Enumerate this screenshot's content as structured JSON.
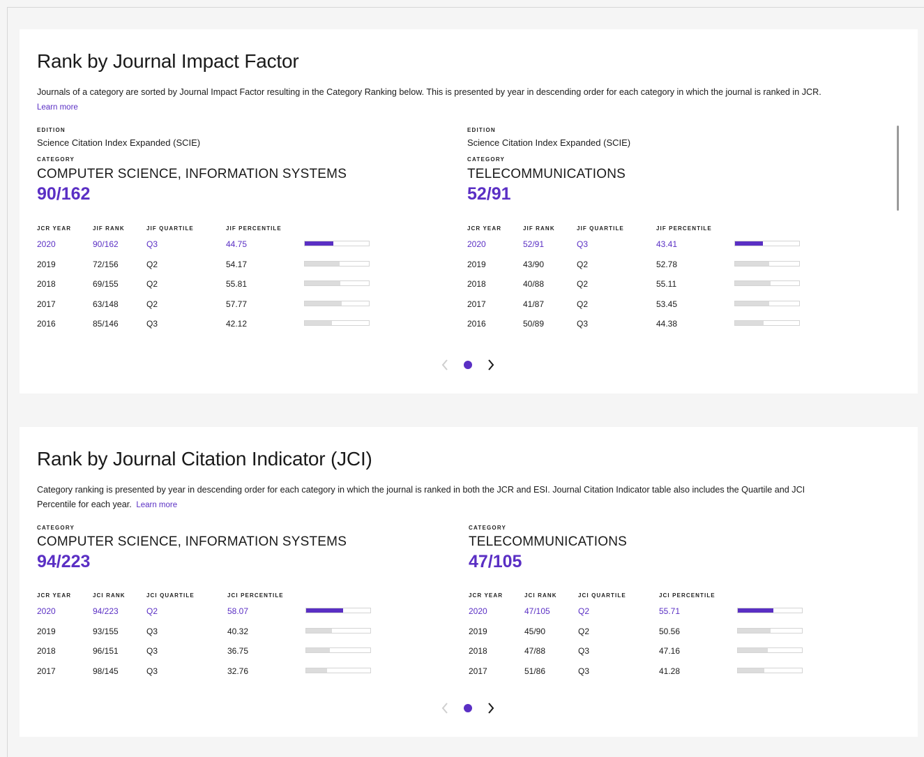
{
  "jif_section": {
    "title": "Rank by Journal Impact Factor",
    "description": "Journals of a category are sorted by Journal Impact Factor resulting in the Category Ranking below. This is presented by year in descending order for each category in which the journal is ranked in JCR.",
    "learn_more": "Learn more",
    "edition_label": "EDITION",
    "category_label": "CATEGORY",
    "headers": [
      "JCR YEAR",
      "JIF RANK",
      "JIF QUARTILE",
      "JIF PERCENTILE"
    ],
    "categories": [
      {
        "edition": "Science Citation Index Expanded (SCIE)",
        "name": "COMPUTER SCIENCE, INFORMATION SYSTEMS",
        "rank": "90/162",
        "rows": [
          {
            "year": "2020",
            "rank": "90/162",
            "quartile": "Q3",
            "percentile": "44.75"
          },
          {
            "year": "2019",
            "rank": "72/156",
            "quartile": "Q2",
            "percentile": "54.17"
          },
          {
            "year": "2018",
            "rank": "69/155",
            "quartile": "Q2",
            "percentile": "55.81"
          },
          {
            "year": "2017",
            "rank": "63/148",
            "quartile": "Q2",
            "percentile": "57.77"
          },
          {
            "year": "2016",
            "rank": "85/146",
            "quartile": "Q3",
            "percentile": "42.12"
          }
        ]
      },
      {
        "edition": "Science Citation Index Expanded (SCIE)",
        "name": "TELECOMMUNICATIONS",
        "rank": "52/91",
        "rows": [
          {
            "year": "2020",
            "rank": "52/91",
            "quartile": "Q3",
            "percentile": "43.41"
          },
          {
            "year": "2019",
            "rank": "43/90",
            "quartile": "Q2",
            "percentile": "52.78"
          },
          {
            "year": "2018",
            "rank": "40/88",
            "quartile": "Q2",
            "percentile": "55.11"
          },
          {
            "year": "2017",
            "rank": "41/87",
            "quartile": "Q2",
            "percentile": "53.45"
          },
          {
            "year": "2016",
            "rank": "50/89",
            "quartile": "Q3",
            "percentile": "44.38"
          }
        ]
      }
    ]
  },
  "jci_section": {
    "title": "Rank by Journal Citation Indicator (JCI)",
    "description": "Category ranking is presented by year in descending order for each category in which the journal is ranked in both the JCR and ESI. Journal Citation Indicator table also includes the Quartile and JCI Percentile for each year.",
    "learn_more": "Learn more",
    "category_label": "CATEGORY",
    "headers": [
      "JCR YEAR",
      "JCI RANK",
      "JCI QUARTILE",
      "JCI PERCENTILE"
    ],
    "categories": [
      {
        "name": "COMPUTER SCIENCE, INFORMATION SYSTEMS",
        "rank": "94/223",
        "rows": [
          {
            "year": "2020",
            "rank": "94/223",
            "quartile": "Q2",
            "percentile": "58.07"
          },
          {
            "year": "2019",
            "rank": "93/155",
            "quartile": "Q3",
            "percentile": "40.32"
          },
          {
            "year": "2018",
            "rank": "96/151",
            "quartile": "Q3",
            "percentile": "36.75"
          },
          {
            "year": "2017",
            "rank": "98/145",
            "quartile": "Q3",
            "percentile": "32.76"
          }
        ]
      },
      {
        "name": "TELECOMMUNICATIONS",
        "rank": "47/105",
        "rows": [
          {
            "year": "2020",
            "rank": "47/105",
            "quartile": "Q2",
            "percentile": "55.71"
          },
          {
            "year": "2019",
            "rank": "45/90",
            "quartile": "Q2",
            "percentile": "50.56"
          },
          {
            "year": "2018",
            "rank": "47/88",
            "quartile": "Q3",
            "percentile": "47.16"
          },
          {
            "year": "2017",
            "rank": "51/86",
            "quartile": "Q3",
            "percentile": "41.28"
          }
        ]
      }
    ]
  },
  "colors": {
    "accent": "#5a2fc4",
    "bar_fill": "#dcdcdc",
    "bar_border": "#d4d4d4",
    "page_bg": "#f5f5f5"
  },
  "icons": {
    "prev": "chevron-left-icon",
    "next": "chevron-right-icon",
    "page": "page-dot-icon"
  }
}
